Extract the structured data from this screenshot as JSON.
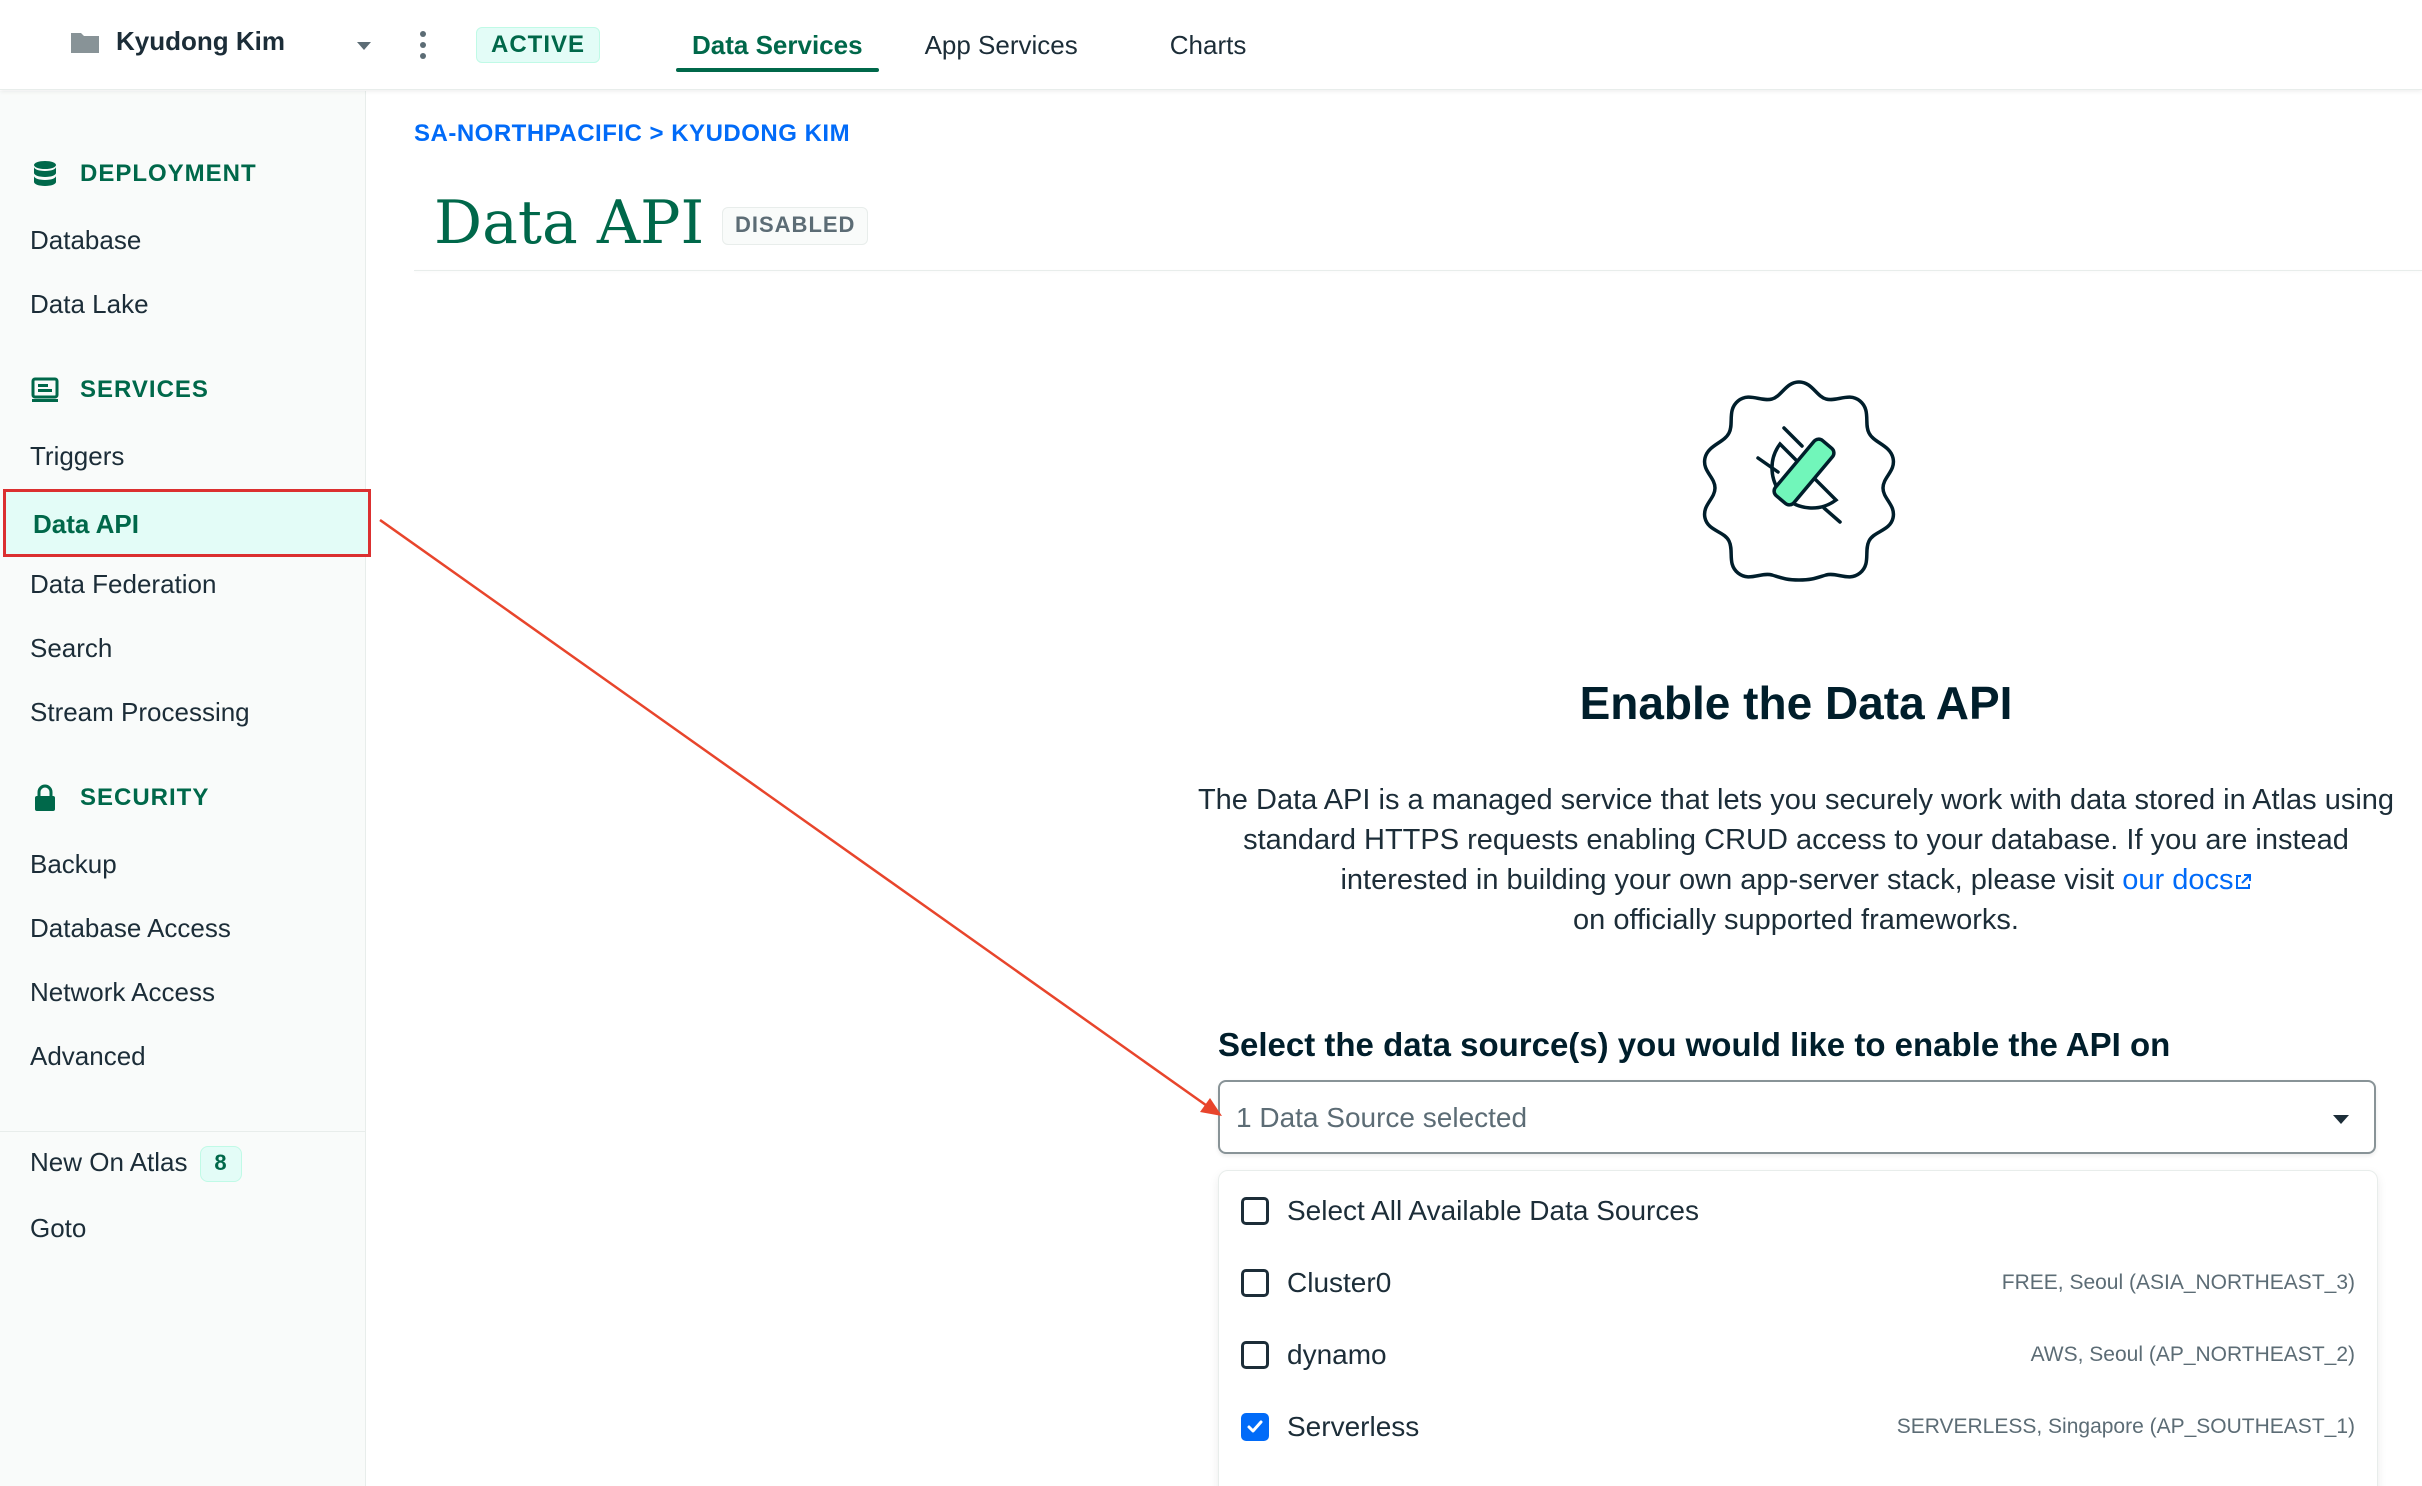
{
  "topbar": {
    "org_name": "Kyudong Kim",
    "status": "ACTIVE",
    "nav": {
      "data_services": "Data Services",
      "app_services": "App Services",
      "charts": "Charts"
    }
  },
  "sidebar": {
    "deployment": {
      "heading": "DEPLOYMENT",
      "items": [
        "Database",
        "Data Lake"
      ]
    },
    "services": {
      "heading": "SERVICES",
      "items": [
        "Triggers",
        "Data API",
        "Data Federation",
        "Search",
        "Stream Processing"
      ]
    },
    "security": {
      "heading": "SECURITY",
      "items": [
        "Backup",
        "Database Access",
        "Network Access",
        "Advanced"
      ]
    },
    "new_on_atlas": {
      "label": "New On Atlas",
      "count": "8"
    },
    "goto": "Goto"
  },
  "main": {
    "breadcrumb": "SA-NORTHPACIFIC > KYUDONG KIM",
    "title": "Data API",
    "status_badge": "DISABLED",
    "enable_title": "Enable the Data API",
    "description_text": "The Data API is a managed service that lets you securely work with data stored in Atlas using standard HTTPS requests enabling CRUD access to your database. If you are instead interested in building your own app-server stack, please visit",
    "description_link": "our docs",
    "description_tail": "on officially supported frameworks.",
    "select_label": "Select the data source(s) you would like to enable the API on",
    "select_value": "1 Data Source selected",
    "options": [
      {
        "label": "Select All Available Data Sources",
        "meta": "",
        "checked": false
      },
      {
        "label": "Cluster0",
        "meta": "FREE, Seoul (ASIA_NORTHEAST_3)",
        "checked": false
      },
      {
        "label": "dynamo",
        "meta": "AWS, Seoul (AP_NORTHEAST_2)",
        "checked": false
      },
      {
        "label": "Serverless",
        "meta": "SERVERLESS, Singapore (AP_SOUTHEAST_1)",
        "checked": true
      }
    ]
  },
  "colors": {
    "brand_green": "#00684A",
    "link_blue": "#016BF8",
    "highlight_red": "#DB3030",
    "pill_bg": "#E3FCF7"
  }
}
